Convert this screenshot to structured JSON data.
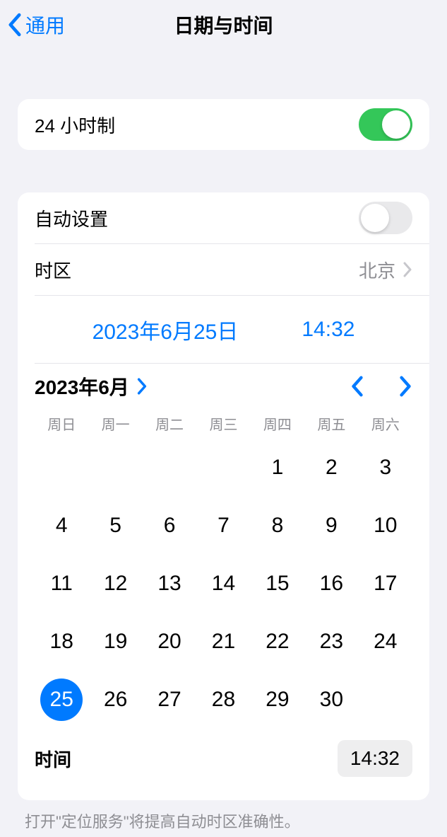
{
  "nav": {
    "back_label": "通用",
    "title": "日期与时间"
  },
  "toggles": {
    "twenty_four_label": "24 小时制",
    "twenty_four_on": true,
    "auto_set_label": "自动设置",
    "auto_set_on": false
  },
  "timezone": {
    "label": "时区",
    "value": "北京"
  },
  "picker": {
    "date_display": "2023年6月25日",
    "time_display": "14:32"
  },
  "calendar": {
    "month_header": "2023年6月",
    "weekdays": [
      "周日",
      "周一",
      "周二",
      "周三",
      "周四",
      "周五",
      "周六"
    ],
    "leading_blanks": 4,
    "days_in_month": 30,
    "selected_day": 25
  },
  "time_row": {
    "label": "时间",
    "value": "14:32"
  },
  "footer": "打开\"定位服务\"将提高自动时区准确性。"
}
